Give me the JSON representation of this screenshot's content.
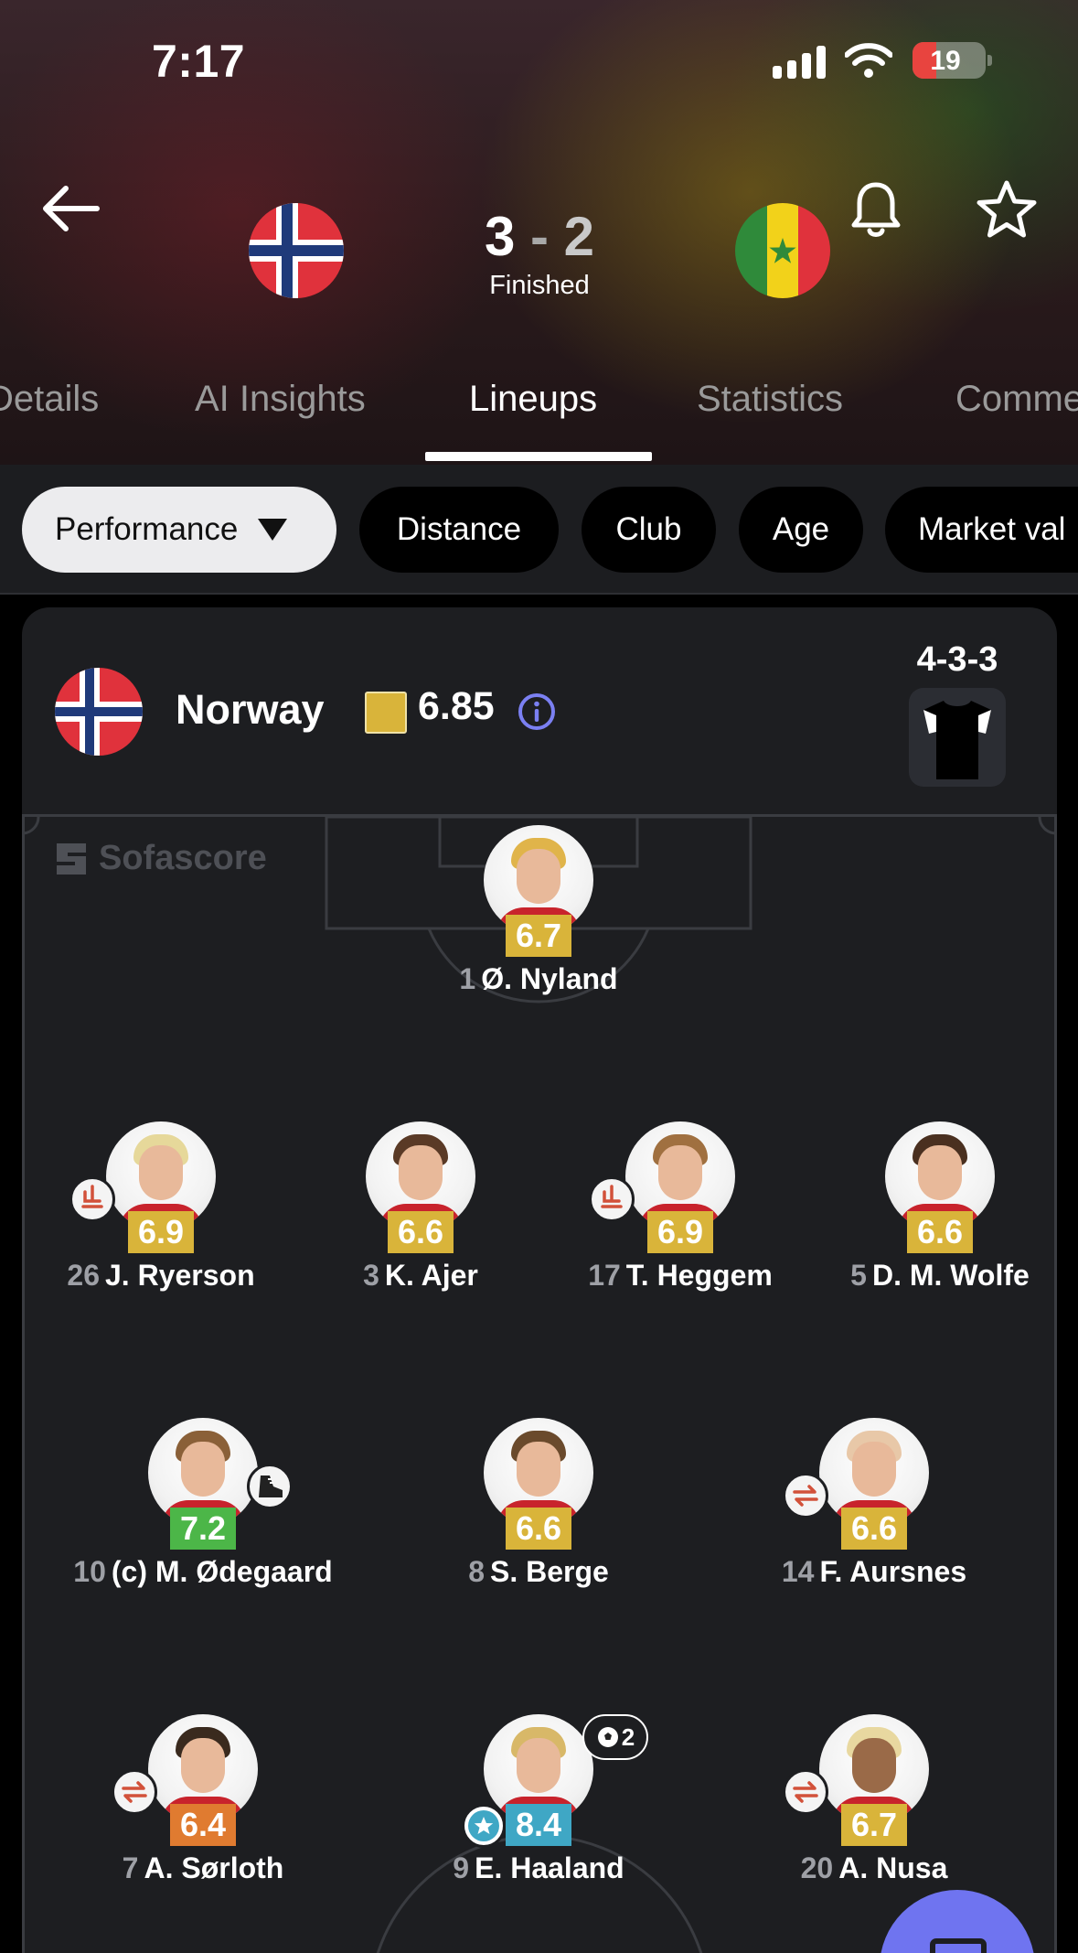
{
  "status_bar": {
    "time": "7:17",
    "battery": "19"
  },
  "match": {
    "home_team": "Norway",
    "home_score": "3",
    "separator": "-",
    "away_score": "2",
    "status": "Finished"
  },
  "tabs": [
    "Details",
    "AI Insights",
    "Lineups",
    "Statistics",
    "Comme"
  ],
  "active_tab": "Lineups",
  "filters": [
    "Performance",
    "Distance",
    "Club",
    "Age",
    "Market val"
  ],
  "team_card": {
    "name": "Norway",
    "rating": "6.85",
    "formation": "4-3-3",
    "watermark": "Sofascore"
  },
  "colors": {
    "rating_yellow": "#d9b43a",
    "rating_green": "#4cb648",
    "rating_orange": "#e07b30",
    "rating_blue": "#3fa7c5",
    "accent_purple": "#6f74f0"
  },
  "players": [
    {
      "number": "1",
      "name": "Ø. Nyland",
      "rating": "6.7",
      "rating_color": "#d9b43a",
      "badges": [],
      "hair": "#e0b44a"
    },
    {
      "number": "26",
      "name": "J. Ryerson",
      "rating": "6.9",
      "rating_color": "#d9b43a",
      "badges": [
        "substitution-out-icon"
      ],
      "hair": "#e6d89a"
    },
    {
      "number": "3",
      "name": "K. Ajer",
      "rating": "6.6",
      "rating_color": "#d9b43a",
      "badges": [],
      "hair": "#5a3a26"
    },
    {
      "number": "17",
      "name": "T. Heggem",
      "rating": "6.9",
      "rating_color": "#d9b43a",
      "badges": [
        "substitution-out-icon"
      ],
      "hair": "#a07040"
    },
    {
      "number": "5",
      "name": "D. M. Wolfe",
      "rating": "6.6",
      "rating_color": "#d9b43a",
      "badges": [],
      "hair": "#4a3020"
    },
    {
      "number": "10",
      "name": "(c) M. Ødegaard",
      "rating": "7.2",
      "rating_color": "#4cb648",
      "badges": [
        "assist-boot-icon"
      ],
      "hair": "#8a6038"
    },
    {
      "number": "8",
      "name": "S. Berge",
      "rating": "6.6",
      "rating_color": "#d9b43a",
      "badges": [],
      "hair": "#6a4a2c"
    },
    {
      "number": "14",
      "name": "F. Aursnes",
      "rating": "6.6",
      "rating_color": "#d9b43a",
      "badges": [
        "substitution-icon"
      ],
      "hair": "#e8c8a8"
    },
    {
      "number": "7",
      "name": "A. Sørloth",
      "rating": "6.4",
      "rating_color": "#e07b30",
      "badges": [
        "substitution-icon"
      ],
      "hair": "#3a2a1e"
    },
    {
      "number": "9",
      "name": "E. Haaland",
      "rating": "8.4",
      "rating_color": "#3fa7c5",
      "badges": [
        "player-of-match-star-icon",
        "goals-ball-icon"
      ],
      "goals": "2",
      "hair": "#d8b868"
    },
    {
      "number": "20",
      "name": "A. Nusa",
      "rating": "6.7",
      "rating_color": "#d9b43a",
      "badges": [
        "substitution-icon"
      ],
      "hair": "#e8d8a0"
    }
  ]
}
